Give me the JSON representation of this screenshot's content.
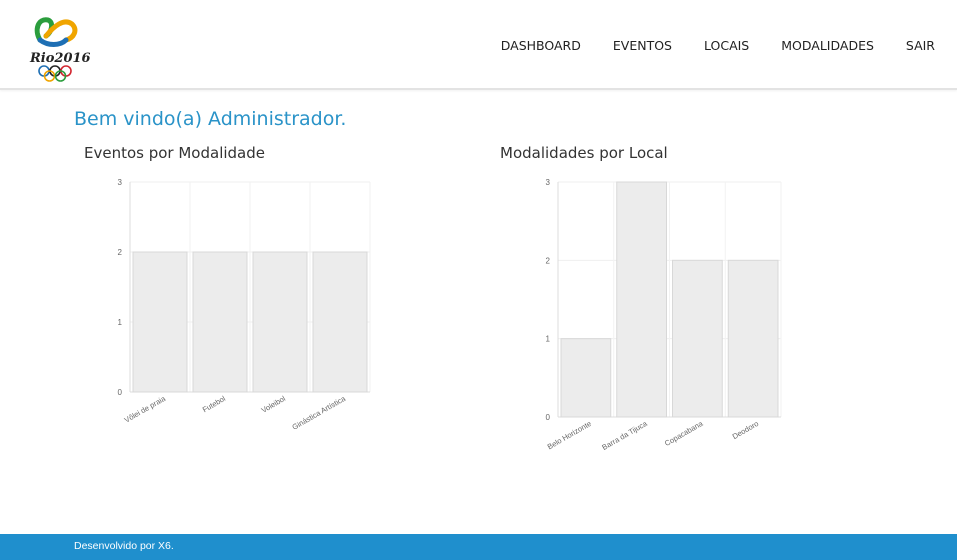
{
  "header": {
    "logo": {
      "text": "Rio2016",
      "icon": "rio-2016-olympic-logo",
      "colors": [
        "#2b9d3d",
        "#f0a500",
        "#1e6fb4",
        "#d22630",
        "#222222"
      ]
    },
    "nav": [
      {
        "label": "DASHBOARD"
      },
      {
        "label": "EVENTOS"
      },
      {
        "label": "LOCAIS"
      },
      {
        "label": "MODALIDADES"
      },
      {
        "label": "SAIR"
      }
    ]
  },
  "main": {
    "welcome": "Bem vindo(a) Administrador."
  },
  "chart_data": [
    {
      "type": "bar",
      "title": "Eventos por Modalidade",
      "categories": [
        "Vôlei de praia",
        "Futebol",
        "Voleibol",
        "Ginástica Artística"
      ],
      "values": [
        2,
        2,
        2,
        2
      ],
      "ylim": [
        0,
        3
      ],
      "yticks": [
        0,
        1,
        2,
        3
      ],
      "grid": true,
      "bar_color": "#ececec",
      "bar_border": "#d8d8d8"
    },
    {
      "type": "bar",
      "title": "Modalidades por Local",
      "categories": [
        "Belo Horizonte",
        "Barra da Tijuca",
        "Copacabana",
        "Deodoro"
      ],
      "values": [
        1,
        3,
        2,
        2
      ],
      "ylim": [
        0,
        3
      ],
      "yticks": [
        0,
        1,
        2,
        3
      ],
      "grid": true,
      "bar_color": "#ececec",
      "bar_border": "#d8d8d8"
    }
  ],
  "footer": {
    "text": "Desenvolvido por X6."
  }
}
